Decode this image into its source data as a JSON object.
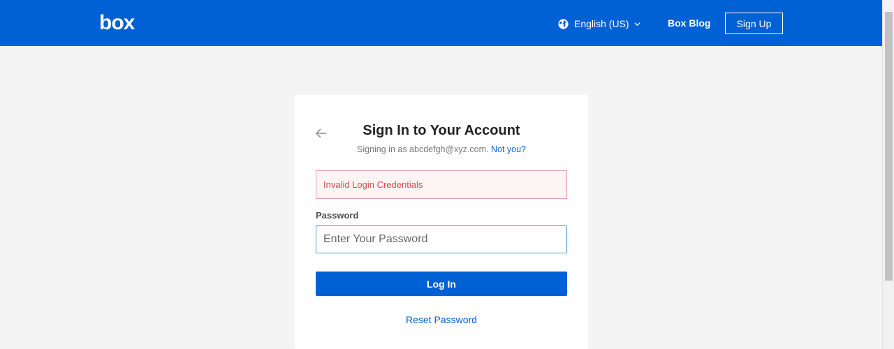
{
  "header": {
    "logo_text": "box",
    "language_label": "English (US)",
    "blog_label": "Box Blog",
    "signup_label": "Sign Up",
    "background_color": "#0061d5",
    "icons": [
      "globe-icon",
      "chevron-down-icon"
    ]
  },
  "card": {
    "title": "Sign In to Your Account",
    "signing_in_prefix": "Signing in as abcdefgh@xyz.com.",
    "not_you_label": "Not you?",
    "error_message": "Invalid Login Credentials",
    "password_label": "Password",
    "password_placeholder": "Enter Your Password",
    "password_value": "",
    "login_label": "Log In",
    "reset_label": "Reset Password",
    "back_icon": "arrow-left-icon"
  },
  "colors": {
    "accent": "#0061d5",
    "error_text": "#d84a52",
    "error_border": "#ec9da2",
    "error_bg": "#fdf4f4",
    "page_bg": "#f4f4f4"
  }
}
